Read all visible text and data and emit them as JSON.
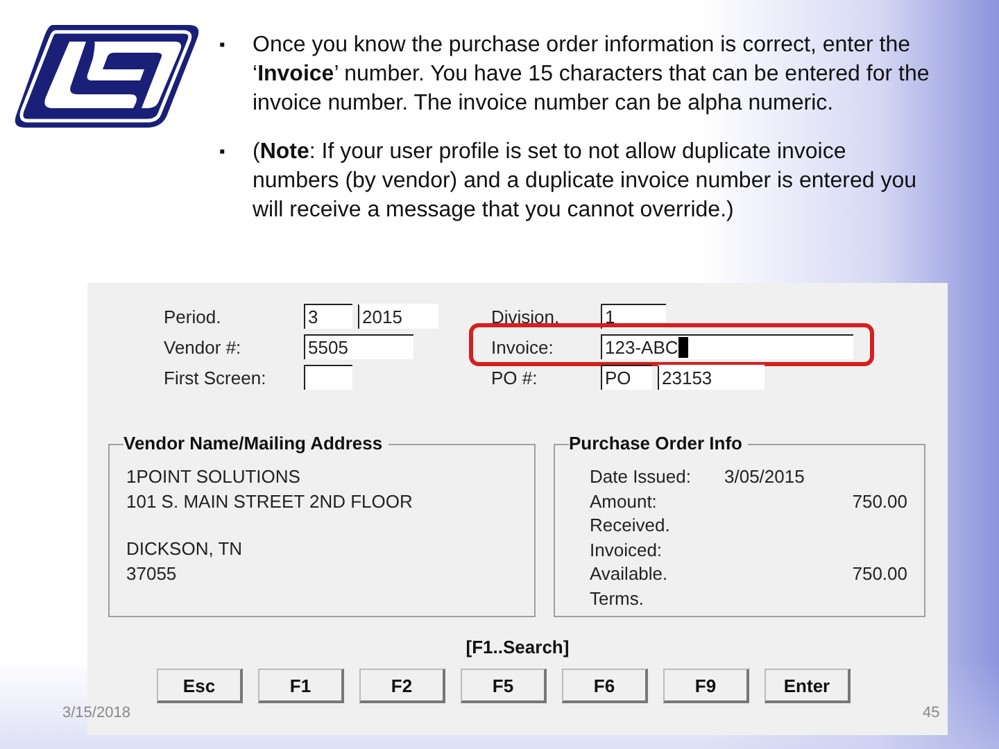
{
  "bullets": [
    {
      "marker": "▪",
      "text": "Once you know the purchase order information is correct, enter the ‘**Invoice**’ number.  You have 15 characters that can be entered for the invoice number.  The invoice number can be alpha numeric."
    },
    {
      "marker": "▪",
      "text": "(**Note**:  If your user profile is set to not allow duplicate invoice numbers (by vendor) and a duplicate invoice number is entered you will receive a message that you cannot override.)"
    }
  ],
  "form": {
    "left_fields": [
      {
        "label": "Period.",
        "values": [
          "3",
          "2015"
        ],
        "highlighted": false,
        "cursor": false
      },
      {
        "label": "Vendor #:",
        "values": [
          "5505"
        ],
        "highlighted": false,
        "cursor": false
      },
      {
        "label": "First Screen:",
        "highlighted": false,
        "cursor": false
      }
    ],
    "right_fields": [
      {
        "label": "Division.",
        "values": [
          "1"
        ],
        "highlighted": false,
        "cursor": false
      },
      {
        "label": "Invoice:",
        "values": [
          "123-ABC"
        ],
        "highlighted": true,
        "cursor": true
      },
      {
        "label": "PO #:",
        "values": [
          "PO",
          "23153"
        ],
        "highlighted": false,
        "cursor": false
      }
    ]
  },
  "vendor_box": {
    "title": "Vendor Name/Mailing Address",
    "address_lines": [
      "1POINT SOLUTIONS",
      "101 S. MAIN STREET 2ND FLOOR"
    ],
    "city_lines": [
      "DICKSON, TN",
      "37055"
    ]
  },
  "po_box": {
    "title": "Purchase Order Info",
    "rows": [
      {
        "label": "Date Issued:",
        "value": "3/05/2015",
        "kind": "date"
      },
      {
        "label": "Amount:",
        "value": "750.00",
        "kind": "amount"
      },
      {
        "label": "Received."
      },
      {
        "label": "Invoiced:"
      },
      {
        "label": "Available.",
        "value": "750.00",
        "kind": "amount"
      },
      {
        "label": "Terms."
      }
    ]
  },
  "hint": "[F1..Search]",
  "buttons": [
    "Esc",
    "F1",
    "F2",
    "F5",
    "F6",
    "F9",
    "Enter"
  ],
  "footer": {
    "date": "3/15/2018",
    "slide_number": "45"
  }
}
